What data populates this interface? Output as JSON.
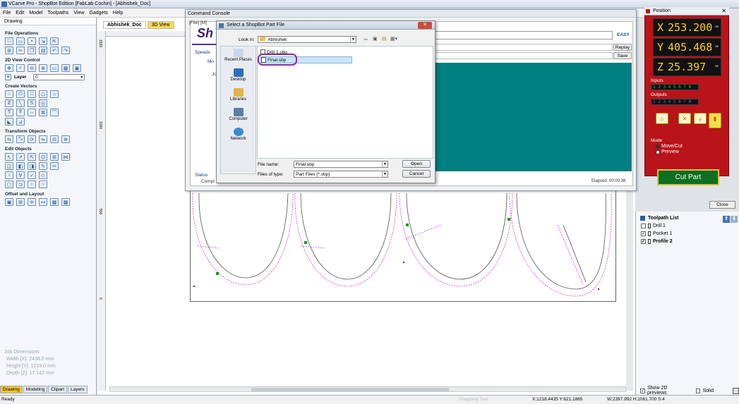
{
  "app": {
    "title": "VCarve Pro - ShopBot Edition [FabLab Cochin] - [Abhishek_Doc]"
  },
  "menu": [
    "File",
    "Edit",
    "Model",
    "Toolpaths",
    "View",
    "Gadgets",
    "Help"
  ],
  "left_panel": {
    "title": "Drawing",
    "sections": {
      "file_operations": "File Operations",
      "view_control": "2D View Control",
      "layer_label": "Layer",
      "layer_value": "0",
      "create_vectors": "Create Vectors",
      "transform_objects": "Transform Objects",
      "edit_objects": "Edit Objects",
      "offset_layout": "Offset and Layout"
    },
    "job": {
      "title": "Job Dimensions",
      "width": "Width  [X]: 2438.0 mm",
      "height": "Height [Y]: 1219.0 mm",
      "depth": "Depth  [Z]: 17.142 mm"
    },
    "tabs": [
      "Drawing",
      "Modeling",
      "Clipart",
      "Layers"
    ]
  },
  "doc_tabs": [
    "Abhishek_Doc",
    "3D View"
  ],
  "ruler": {
    "v1": "1500",
    "v2": "1000",
    "v3": "500",
    "v4": "0"
  },
  "console": {
    "title": "Command Console",
    "menu": "[File] [M]",
    "brand": "Sh",
    "easy": "EASY",
    "replay": "Replay",
    "save": "Save",
    "speeds": "Speeds",
    "mo": "Mo",
    "jo": "Jo",
    "status": "Status",
    "compl": "Compl",
    "elapsed": "Elapsed: 00:00:38"
  },
  "dialog": {
    "title": "Select a ShopBot Part File",
    "look_in_label": "Look in:",
    "look_in_value": "Abhishek",
    "places": [
      "Recent Places",
      "Desktop",
      "Libraries",
      "Computer",
      "Network"
    ],
    "files": [
      "Drill 1.sbp",
      "Final.sbp"
    ],
    "file_name_label": "File name:",
    "file_name_value": "Final.sbp",
    "file_type_label": "Files of type:",
    "file_type_value": "Part Files (*.sbp)",
    "open": "Open",
    "cancel": "Cancel"
  },
  "position": {
    "title": "Position",
    "x_label": "X",
    "x_value": "253.200",
    "y_label": "Y",
    "y_value": "405.468",
    "z_label": "Z",
    "z_value": "25.397",
    "unit": "mm",
    "inputs_label": "Inputs",
    "inputs_value": "1 2 3 4   5 6 7 8",
    "outputs_label": "Outputs",
    "outputs_value": "1 2 3 4   5 6 7 8",
    "mode_label": "Mode",
    "mode_move": "Move/Cut",
    "mode_preview": "Preview",
    "cut_part": "Cut Part"
  },
  "right_panel": {
    "close": "Close",
    "toolpath_list": "Toolpath List",
    "toolpaths": [
      {
        "name": "Drill 1",
        "checked": false
      },
      {
        "name": "Pocket 1",
        "checked": true
      },
      {
        "name": "Profile 2",
        "checked": true
      }
    ],
    "show_previews": "Show 2D previews",
    "solid": "Solid"
  },
  "statusbar": {
    "ready": "Ready",
    "coords": "X:1218.4435 Y:621.1865",
    "dims": "W:2397.992  H:1061.700  S:4",
    "ghost": "Snapping Tool"
  }
}
